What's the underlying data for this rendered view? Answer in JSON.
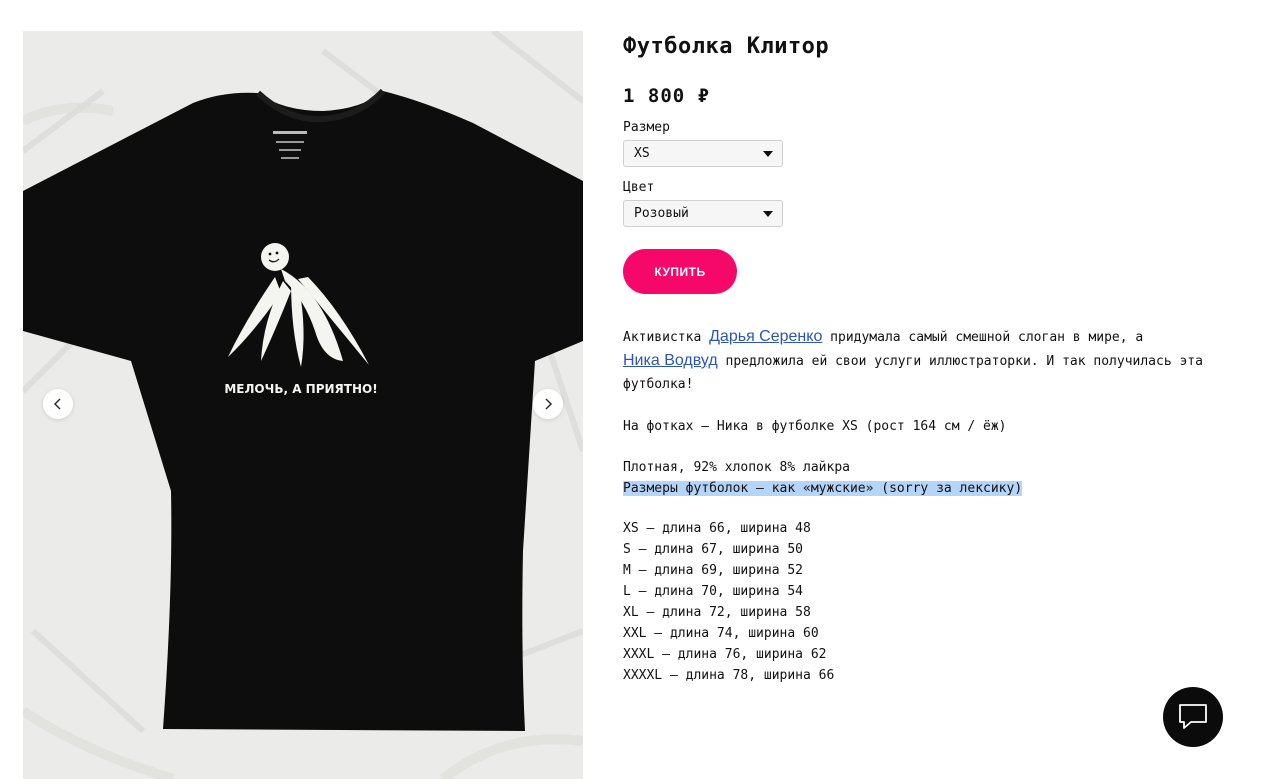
{
  "product": {
    "title": "Футболка Клитор",
    "price": "1 800 ₽",
    "size": {
      "label": "Размер",
      "selected": "XS"
    },
    "color": {
      "label": "Цвет",
      "selected": "Розовый"
    },
    "buy_label": "КУПИТЬ"
  },
  "gallery": {
    "shirt_print_text": "МЕЛОЧЬ, А ПРИЯТНО!",
    "left_arrow_icon": "chevron-left-icon",
    "right_arrow_icon": "chevron-right-icon"
  },
  "description": {
    "p1_prefix": "Активистка ",
    "link1": "Дарья Серенко",
    "p1_mid": " придумала самый смешной слоган в мире, а",
    "link2": "Ника Водвуд",
    "p1_suffix": " предложила ей свои услуги иллюстраторки. И так получилась эта футболка!",
    "p2": "На фотках — Ника в футболке XS (рост 164 см / ёж)",
    "p3_line1": "Плотная, 92% хлопок 8% лайкра",
    "p3_line2": "Размеры футболок — как «мужские» (sorry за лексику)",
    "sizes": [
      "XS — длина 66, ширина 48",
      "S — длина 67, ширина 50",
      "M — длина 69, ширина 52",
      "L — длина 70, ширина 54",
      "XL — длина 72, ширина 58",
      "XXL — длина 74, ширина 60",
      "XXXL — длина 76, ширина 62",
      "XXXXL — длина 78, ширина 66"
    ]
  },
  "chat": {
    "icon": "chat-icon"
  },
  "colors": {
    "accent": "#f5086a",
    "link": "#2d55b7",
    "selection": "#b4d4f8"
  }
}
